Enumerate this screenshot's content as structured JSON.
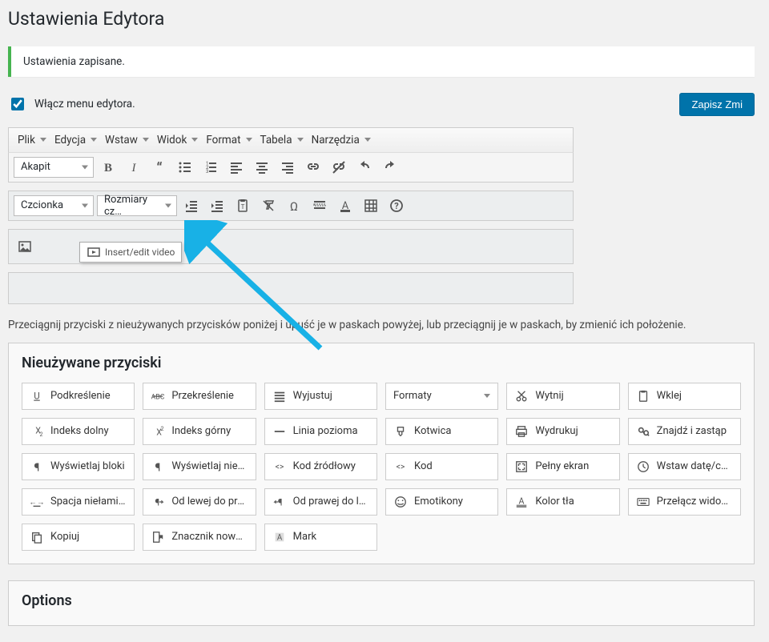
{
  "page": {
    "title": "Ustawienia Edytora",
    "notice": "Ustawienia zapisane.",
    "enable_label": "Włącz menu edytora.",
    "save_label": "Zapisz Zmi",
    "instructions": "Przeciągnij przyciski z nieużywanych przycisków poniżej i upuść je w paskach powyżej, lub przeciągnij je w paskach, by zmienić ich położenie."
  },
  "menubar": [
    "Plik",
    "Edycja",
    "Wstaw",
    "Widok",
    "Format",
    "Tabela",
    "Narzędzia"
  ],
  "toolbar1": {
    "paragraph_select": "Akapit"
  },
  "toolbar2": {
    "font_select": "Czcionka",
    "size_select": "Rozmiary cz…"
  },
  "tooltip_video": "Insert/edit video",
  "unused": {
    "title": "Nieużywane przyciski",
    "buttons": [
      {
        "icon": "underline",
        "label": "Podkreślenie"
      },
      {
        "icon": "strike",
        "label": "Przekreślenie"
      },
      {
        "icon": "justify",
        "label": "Wyjustuj"
      },
      {
        "icon": "select",
        "label": "Formaty"
      },
      {
        "icon": "cut",
        "label": "Wytnij"
      },
      {
        "icon": "paste",
        "label": "Wklej"
      },
      {
        "icon": "sub",
        "label": "Indeks dolny"
      },
      {
        "icon": "sup",
        "label": "Indeks górny"
      },
      {
        "icon": "hr",
        "label": "Linia pozioma"
      },
      {
        "icon": "anchor",
        "label": "Kotwica"
      },
      {
        "icon": "print",
        "label": "Wydrukuj"
      },
      {
        "icon": "find",
        "label": "Znajdź i zastąp"
      },
      {
        "icon": "pilcrow",
        "label": "Wyświetlaj bloki"
      },
      {
        "icon": "pilcrow",
        "label": "Wyświetlaj niedruko…"
      },
      {
        "icon": "code",
        "label": "Kod źródłowy"
      },
      {
        "icon": "code",
        "label": "Kod"
      },
      {
        "icon": "fullscreen",
        "label": "Pełny ekran"
      },
      {
        "icon": "clock",
        "label": "Wstaw datę/czas"
      },
      {
        "icon": "nbsp",
        "label": "Spacja niełamiąca"
      },
      {
        "icon": "ltr",
        "label": "Od lewej do prawej"
      },
      {
        "icon": "rtl",
        "label": "Od prawej do lewej"
      },
      {
        "icon": "smile",
        "label": "Emotikony"
      },
      {
        "icon": "bgcolor",
        "label": "Kolor tła"
      },
      {
        "icon": "keyboard",
        "label": "Przełącz widoczność…"
      },
      {
        "icon": "copy",
        "label": "Kopiuj"
      },
      {
        "icon": "bookmark",
        "label": "Znacznik nowej stro…"
      },
      {
        "icon": "mark",
        "label": "Mark"
      }
    ]
  },
  "options": {
    "title": "Options"
  }
}
